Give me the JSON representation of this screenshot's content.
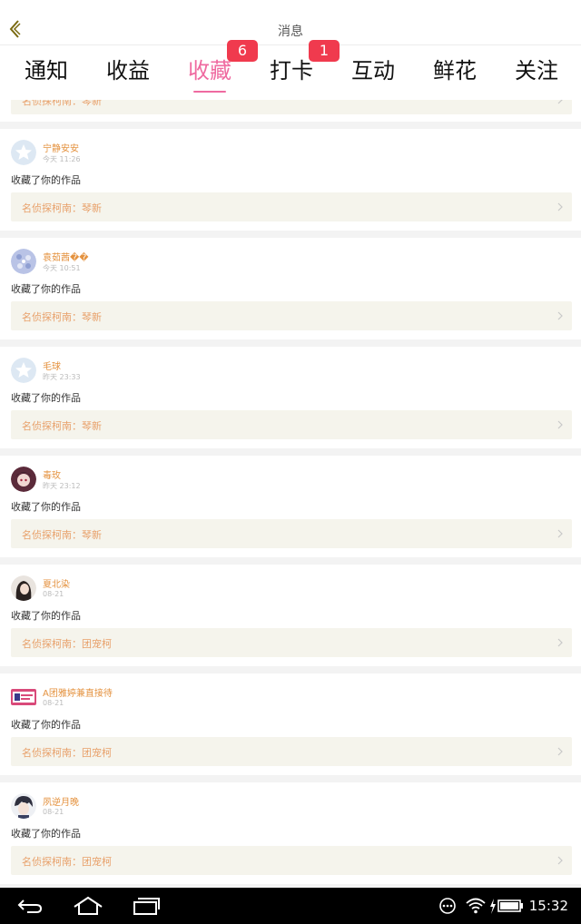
{
  "header": {
    "title": "消息"
  },
  "tabs": [
    {
      "label": "通知"
    },
    {
      "label": "收益"
    },
    {
      "label": "收藏",
      "active": true,
      "badge": "6"
    },
    {
      "label": "打卡",
      "badge": "1"
    },
    {
      "label": "互动"
    },
    {
      "label": "鲜花"
    },
    {
      "label": "关注"
    }
  ],
  "badges": {
    "favorites": "6",
    "checkin": "1"
  },
  "partial_item": {
    "work": "名侦探柯南：琴新"
  },
  "items": [
    {
      "user": "宁静安安",
      "time": "今天 11:26",
      "action": "收藏了你的作品",
      "work": "名侦探柯南：琴新",
      "avatar": "star-avatar"
    },
    {
      "user": "袁茹茜��",
      "time": "今天 10:51",
      "action": "收藏了你的作品",
      "work": "名侦探柯南：琴新",
      "avatar": "pattern-avatar"
    },
    {
      "user": "毛球",
      "time": "昨天 23:33",
      "action": "收藏了你的作品",
      "work": "名侦探柯南：琴新",
      "avatar": "star-avatar"
    },
    {
      "user": "毒玫",
      "time": "昨天 23:12",
      "action": "收藏了你的作品",
      "work": "名侦探柯南：琴新",
      "avatar": "anime-avatar"
    },
    {
      "user": "夏北染",
      "time": "08-21",
      "action": "收藏了你的作品",
      "work": "名侦探柯南：团宠柯",
      "avatar": "girl-avatar"
    },
    {
      "user": "A团雅婷兼直接待",
      "time": "08-21",
      "action": "收藏了你的作品",
      "work": "名侦探柯南：团宠柯",
      "avatar": "banner-avatar"
    },
    {
      "user": "夙逆月晚",
      "time": "08-21",
      "action": "收藏了你的作品",
      "work": "名侦探柯南：团宠柯",
      "avatar": "boy-avatar"
    }
  ],
  "system": {
    "clock": "15:32"
  },
  "colors": {
    "accent": "#ef6aa0",
    "badge": "#f03a4e",
    "username": "#e4923f",
    "work_text": "#e8a06a",
    "work_bg": "#f5f4ec"
  }
}
